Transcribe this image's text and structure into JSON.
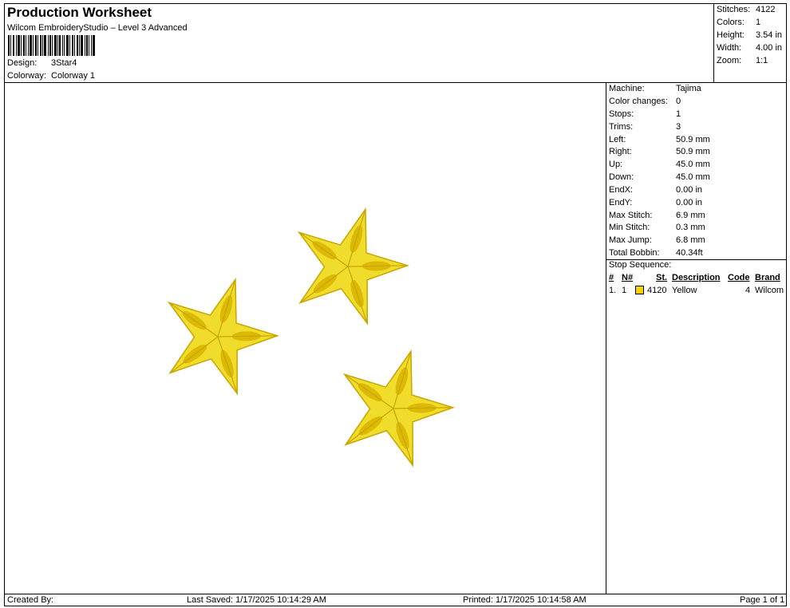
{
  "header": {
    "title": "Production Worksheet",
    "software": "Wilcom EmbroideryStudio – Level 3 Advanced",
    "design_label": "Design:",
    "design_value": "3Star4",
    "colorway_label": "Colorway:",
    "colorway_value": "Colorway 1"
  },
  "summary": {
    "stitches_label": "Stitches:",
    "stitches_value": "4122",
    "colors_label": "Colors:",
    "colors_value": "1",
    "height_label": "Height:",
    "height_value": "3.54 in",
    "width_label": "Width:",
    "width_value": "4.00 in",
    "zoom_label": "Zoom:",
    "zoom_value": "1:1"
  },
  "details": {
    "rows": [
      {
        "label": "Machine:",
        "value": "Tajima"
      },
      {
        "label": "Color changes:",
        "value": "0"
      },
      {
        "label": "Stops:",
        "value": "1"
      },
      {
        "label": "Trims:",
        "value": "3"
      },
      {
        "label": "Left:",
        "value": "50.9 mm"
      },
      {
        "label": "Right:",
        "value": "50.9 mm"
      },
      {
        "label": "Up:",
        "value": "45.0 mm"
      },
      {
        "label": "Down:",
        "value": "45.0 mm"
      },
      {
        "label": "EndX:",
        "value": "0.00 in"
      },
      {
        "label": "EndY:",
        "value": "0.00 in"
      },
      {
        "label": "Max Stitch:",
        "value": "6.9 mm"
      },
      {
        "label": "Min Stitch:",
        "value": "0.3 mm"
      },
      {
        "label": "Max Jump:",
        "value": "6.8 mm"
      },
      {
        "label": "Total Bobbin:",
        "value": "40.34ft"
      }
    ]
  },
  "stop_sequence": {
    "title": "Stop Sequence:",
    "columns": {
      "num": "#",
      "needle": "N#",
      "stitches": "St.",
      "description": "Description",
      "code": "Code",
      "brand": "Brand"
    },
    "rows": [
      {
        "num": "1.",
        "needle": "1",
        "color": "#f5d300",
        "stitches": "4120",
        "description": "Yellow",
        "code": "4",
        "brand": "Wilcom"
      }
    ]
  },
  "design_colors": {
    "star_fill": "#f0dc2a",
    "star_shade": "#d9b600",
    "star_dark": "#c9a500"
  },
  "footer": {
    "created_by": "Created By:",
    "last_saved": "Last Saved: 1/17/2025 10:14:29 AM",
    "printed": "Printed: 1/17/2025 10:14:58 AM",
    "page": "Page 1 of 1"
  }
}
